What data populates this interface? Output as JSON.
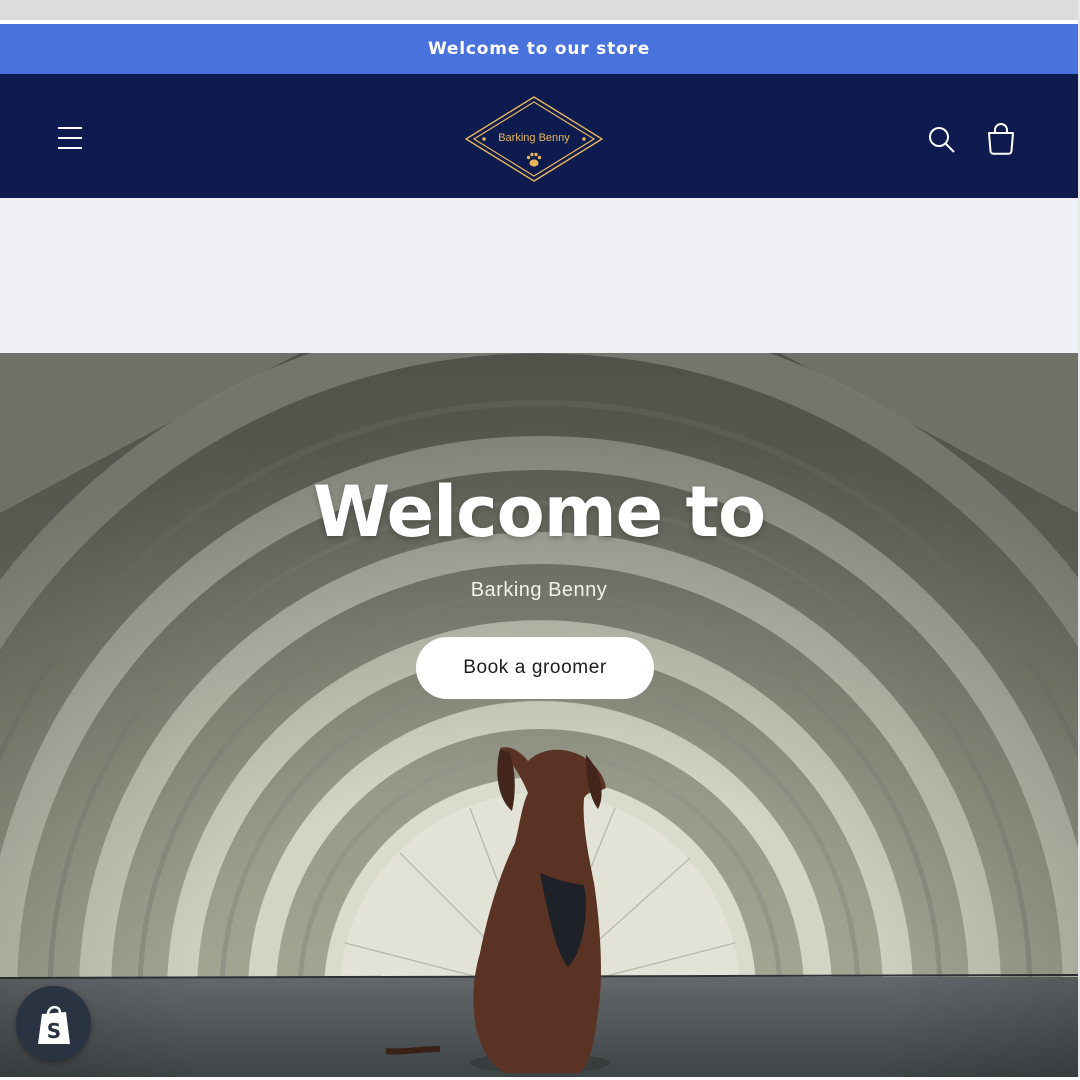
{
  "announcement": {
    "text": "Welcome to our store"
  },
  "header": {
    "logo_text": "Barking Benny",
    "icons": {
      "menu": "hamburger-menu-icon",
      "search": "search-icon",
      "cart": "cart-icon"
    }
  },
  "hero": {
    "title": "Welcome to",
    "subtitle": "Barking Benny",
    "cta_label": "Book a groomer"
  },
  "badge": {
    "icon": "shopify-bag-icon"
  },
  "colors": {
    "announcement_bg": "#4a72dd",
    "header_bg": "#0e1b4f",
    "logo_gold": "#e7b65b",
    "spacer_bg": "#eef0f5",
    "badge_bg": "#2a3342"
  }
}
